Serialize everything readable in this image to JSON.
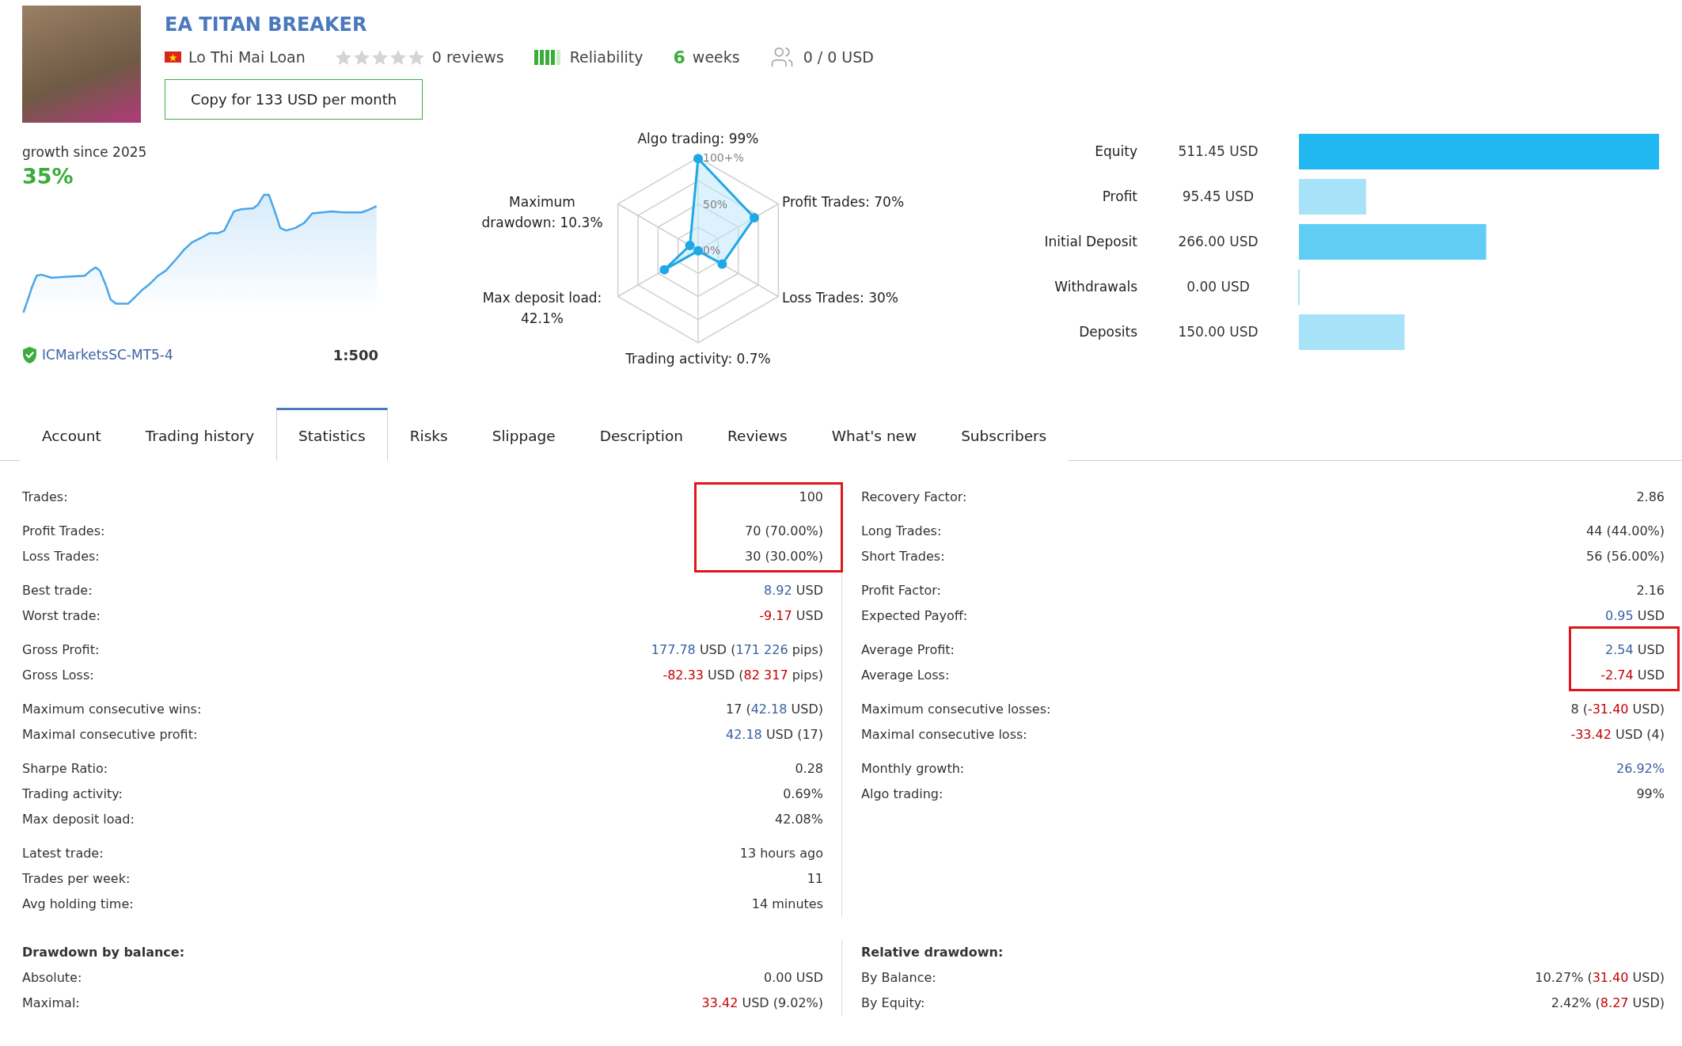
{
  "product": {
    "title": "EA TITAN BREAKER",
    "author": "Lo Thi Mai Loan",
    "rating": {
      "stars": 0,
      "text": "0 reviews"
    },
    "reliability": {
      "label": "Reliability",
      "level": 0.8
    },
    "age": {
      "count": "6",
      "unit": "weeks"
    },
    "subscribers": "0 / 0 USD",
    "copy_button": "Copy for 133 USD per month"
  },
  "growth": {
    "caption": "growth since 2025",
    "value": "35%",
    "broker": "ICMarketsSC-MT5-4",
    "leverage": "1:500"
  },
  "radar": {
    "ring_labels": [
      "100+%",
      "50%",
      "0%"
    ],
    "axes": [
      {
        "name": "Algo trading:",
        "value": "99%"
      },
      {
        "name": "Maximum drawdown:",
        "value": "10.3%"
      },
      {
        "name": "Profit Trades:",
        "value": "70%"
      },
      {
        "name": "Max deposit load:",
        "value": "42.1%"
      },
      {
        "name": "Loss Trades:",
        "value": "30%"
      },
      {
        "name": "Trading activity:",
        "value": "0.7%"
      }
    ]
  },
  "balance": {
    "chart_data": {
      "type": "bar",
      "orientation": "horizontal",
      "categories": [
        "Equity",
        "Profit",
        "Initial Deposit",
        "Withdrawals",
        "Deposits"
      ],
      "values": [
        511.45,
        95.45,
        266.0,
        0,
        150.0
      ],
      "value_labels": [
        "511.45 USD",
        "95.45 USD",
        "266.00 USD",
        "0.00 USD",
        "150.00 USD"
      ],
      "colors": [
        "#21b8f1",
        "#a8e2f8",
        "#61cdf5",
        "#a8e2f8",
        "#a8e2f8"
      ],
      "xlim": [
        0,
        511.45
      ]
    }
  },
  "tabs": [
    {
      "label": "Account",
      "selected": false
    },
    {
      "label": "Trading history",
      "selected": false
    },
    {
      "label": "Statistics",
      "selected": true
    },
    {
      "label": "Risks",
      "selected": false
    },
    {
      "label": "Slippage",
      "selected": false
    },
    {
      "label": "Description",
      "selected": false
    },
    {
      "label": "Reviews",
      "selected": false
    },
    {
      "label": "What's new",
      "selected": false
    },
    {
      "label": "Subscribers",
      "selected": false
    }
  ],
  "statistics": {
    "columns": [
      {
        "groups": [
          {
            "rows": [
              {
                "label": "Trades:",
                "value": "100",
                "highlighted": true
              }
            ]
          },
          {
            "rows": [
              {
                "label": "Profit Trades:",
                "value": "70 (70.00%)",
                "highlighted": true
              },
              {
                "label": "Loss Trades:",
                "value": "30 (30.00%)",
                "highlighted": true
              }
            ]
          },
          {
            "rows": [
              {
                "label": "Best trade:",
                "parts": [
                  {
                    "text": "8.92",
                    "kind": "profit"
                  },
                  {
                    "text": " USD",
                    "kind": "plain"
                  }
                ],
                "highlighted": false
              },
              {
                "label": "Worst trade:",
                "parts": [
                  {
                    "text": "-9.17",
                    "kind": "loss"
                  },
                  {
                    "text": " USD",
                    "kind": "plain"
                  }
                ],
                "highlighted": false
              }
            ]
          },
          {
            "rows": [
              {
                "label": "Gross Profit:",
                "parts": [
                  {
                    "text": "177.78",
                    "kind": "profit"
                  },
                  {
                    "text": " USD (",
                    "kind": "plain"
                  },
                  {
                    "text": "171 226",
                    "kind": "profit"
                  },
                  {
                    "text": " pips)",
                    "kind": "plain"
                  }
                ],
                "highlighted": false
              },
              {
                "label": "Gross Loss:",
                "parts": [
                  {
                    "text": "-82.33",
                    "kind": "loss"
                  },
                  {
                    "text": " USD (",
                    "kind": "plain"
                  },
                  {
                    "text": "82 317",
                    "kind": "loss"
                  },
                  {
                    "text": " pips)",
                    "kind": "plain"
                  }
                ],
                "highlighted": false
              }
            ]
          },
          {
            "rows": [
              {
                "label": "Maximum consecutive wins:",
                "parts": [
                  {
                    "text": "17 (",
                    "kind": "plain"
                  },
                  {
                    "text": "42.18",
                    "kind": "profit"
                  },
                  {
                    "text": " USD)",
                    "kind": "plain"
                  }
                ],
                "highlighted": false
              },
              {
                "label": "Maximal consecutive profit:",
                "parts": [
                  {
                    "text": "42.18",
                    "kind": "profit"
                  },
                  {
                    "text": " USD (17)",
                    "kind": "plain"
                  }
                ],
                "highlighted": false
              }
            ]
          },
          {
            "rows": [
              {
                "label": "Sharpe Ratio:",
                "value": "0.28",
                "highlighted": false
              },
              {
                "label": "Trading activity:",
                "value": "0.69%",
                "highlighted": false
              },
              {
                "label": "Max deposit load:",
                "value": "42.08%",
                "highlighted": false
              }
            ]
          },
          {
            "rows": [
              {
                "label": "Latest trade:",
                "value": "13 hours ago",
                "highlighted": false
              },
              {
                "label": "Trades per week:",
                "value": "11",
                "highlighted": false
              },
              {
                "label": "Avg holding time:",
                "value": "14 minutes",
                "highlighted": false
              }
            ]
          }
        ]
      },
      {
        "groups": [
          {
            "rows": [
              {
                "label": "Recovery Factor:",
                "value": "2.86",
                "highlighted": false
              }
            ]
          },
          {
            "rows": [
              {
                "label": "Long Trades:",
                "value": "44 (44.00%)",
                "highlighted": false
              },
              {
                "label": "Short Trades:",
                "value": "56 (56.00%)",
                "highlighted": false
              }
            ]
          },
          {
            "rows": [
              {
                "label": "Profit Factor:",
                "value": "2.16",
                "highlighted": false
              },
              {
                "label": "Expected Payoff:",
                "parts": [
                  {
                    "text": "0.95",
                    "kind": "profit"
                  },
                  {
                    "text": " USD",
                    "kind": "plain"
                  }
                ],
                "highlighted": false
              }
            ]
          },
          {
            "rows": [
              {
                "label": "Average Profit:",
                "parts": [
                  {
                    "text": "2.54",
                    "kind": "profit"
                  },
                  {
                    "text": " USD",
                    "kind": "plain"
                  }
                ],
                "highlighted": true
              },
              {
                "label": "Average Loss:",
                "parts": [
                  {
                    "text": "-2.74",
                    "kind": "loss"
                  },
                  {
                    "text": " USD",
                    "kind": "plain"
                  }
                ],
                "highlighted": true
              }
            ]
          },
          {
            "rows": [
              {
                "label": "Maximum consecutive losses:",
                "parts": [
                  {
                    "text": "8 (",
                    "kind": "plain"
                  },
                  {
                    "text": "-31.40",
                    "kind": "loss"
                  },
                  {
                    "text": " USD)",
                    "kind": "plain"
                  }
                ],
                "highlighted": false
              },
              {
                "label": "Maximal consecutive loss:",
                "parts": [
                  {
                    "text": "-33.42",
                    "kind": "loss"
                  },
                  {
                    "text": " USD (4)",
                    "kind": "plain"
                  }
                ],
                "highlighted": false
              }
            ]
          },
          {
            "rows": [
              {
                "label": "Monthly growth:",
                "parts": [
                  {
                    "text": "26.92%",
                    "kind": "profit"
                  }
                ],
                "highlighted": false
              },
              {
                "label": "Algo trading:",
                "value": "99%",
                "highlighted": false
              }
            ]
          }
        ]
      }
    ],
    "drawdowns": [
      {
        "title": "Drawdown by balance:",
        "rows": [
          {
            "label": "Absolute:",
            "value": "0.00 USD"
          },
          {
            "label": "Maximal:",
            "parts": [
              {
                "text": "33.42",
                "kind": "loss"
              },
              {
                "text": " USD (9.02%)",
                "kind": "plain"
              }
            ]
          }
        ]
      },
      {
        "title": "Relative drawdown:",
        "rows": [
          {
            "label": "By Balance:",
            "parts": [
              {
                "text": "10.27% (",
                "kind": "plain"
              },
              {
                "text": "31.40",
                "kind": "loss"
              },
              {
                "text": " USD)",
                "kind": "plain"
              }
            ]
          },
          {
            "label": "By Equity:",
            "parts": [
              {
                "text": "2.42% (",
                "kind": "plain"
              },
              {
                "text": "8.27",
                "kind": "loss"
              },
              {
                "text": " USD)",
                "kind": "plain"
              }
            ]
          }
        ]
      }
    ]
  }
}
